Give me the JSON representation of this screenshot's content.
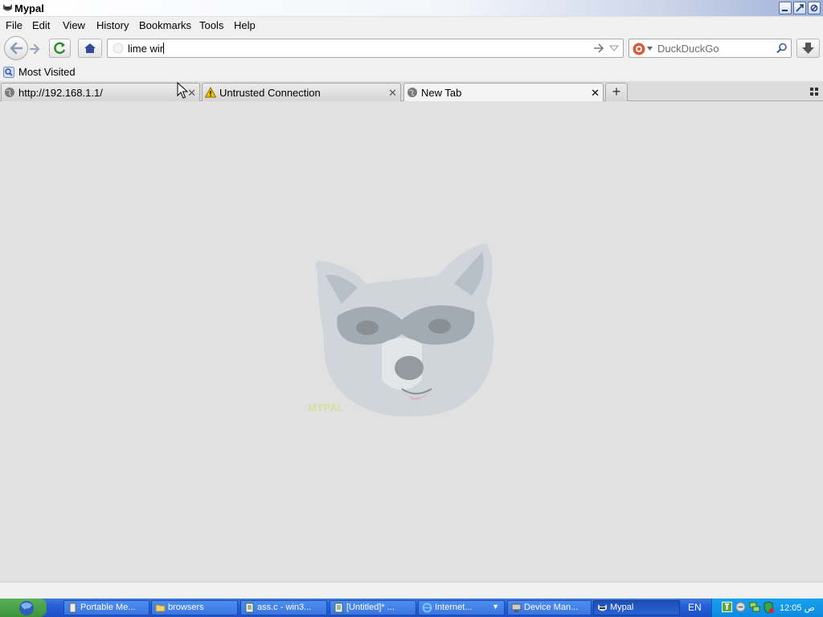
{
  "window": {
    "title": "Mypal"
  },
  "menu": [
    {
      "label": "File"
    },
    {
      "label": "Edit"
    },
    {
      "label": "View"
    },
    {
      "label": "History"
    },
    {
      "label": "Bookmarks"
    },
    {
      "label": "Tools"
    },
    {
      "label": "Help"
    }
  ],
  "navbar": {
    "url_value": "lime wir",
    "search_engine": "DuckDuckGo",
    "search_placeholder": "DuckDuckGo"
  },
  "bookmarks": [
    {
      "label": "Most Visited"
    }
  ],
  "tabs": [
    {
      "label": "http://192.168.1.1/",
      "icon": "globe-icon",
      "selected": false
    },
    {
      "label": "Untrusted Connection",
      "icon": "warning-icon",
      "selected": false
    },
    {
      "label": "New Tab",
      "icon": "globe-icon",
      "selected": true
    }
  ],
  "content": {
    "logo_text": "MYPAL"
  },
  "taskbar": {
    "tasks": [
      {
        "label": "Portable Me...",
        "icon": "app-icon"
      },
      {
        "label": "browsers",
        "icon": "folder-icon"
      },
      {
        "label": "ass.c - win3...",
        "icon": "notepad-icon"
      },
      {
        "label": "[Untitled]* ...",
        "icon": "notepad-icon"
      },
      {
        "label": "Internet...",
        "icon": "ie-icon"
      },
      {
        "label": "Device Man...",
        "icon": "device-manager-icon"
      },
      {
        "label": "Mypal",
        "icon": "mypal-icon",
        "active": true
      }
    ],
    "language": "EN",
    "clock": "12:05 ص"
  },
  "colors": {
    "taskbar_blue": "#245edb",
    "tray_blue": "#0e8ae0",
    "content_bg": "#e1e1e1"
  }
}
